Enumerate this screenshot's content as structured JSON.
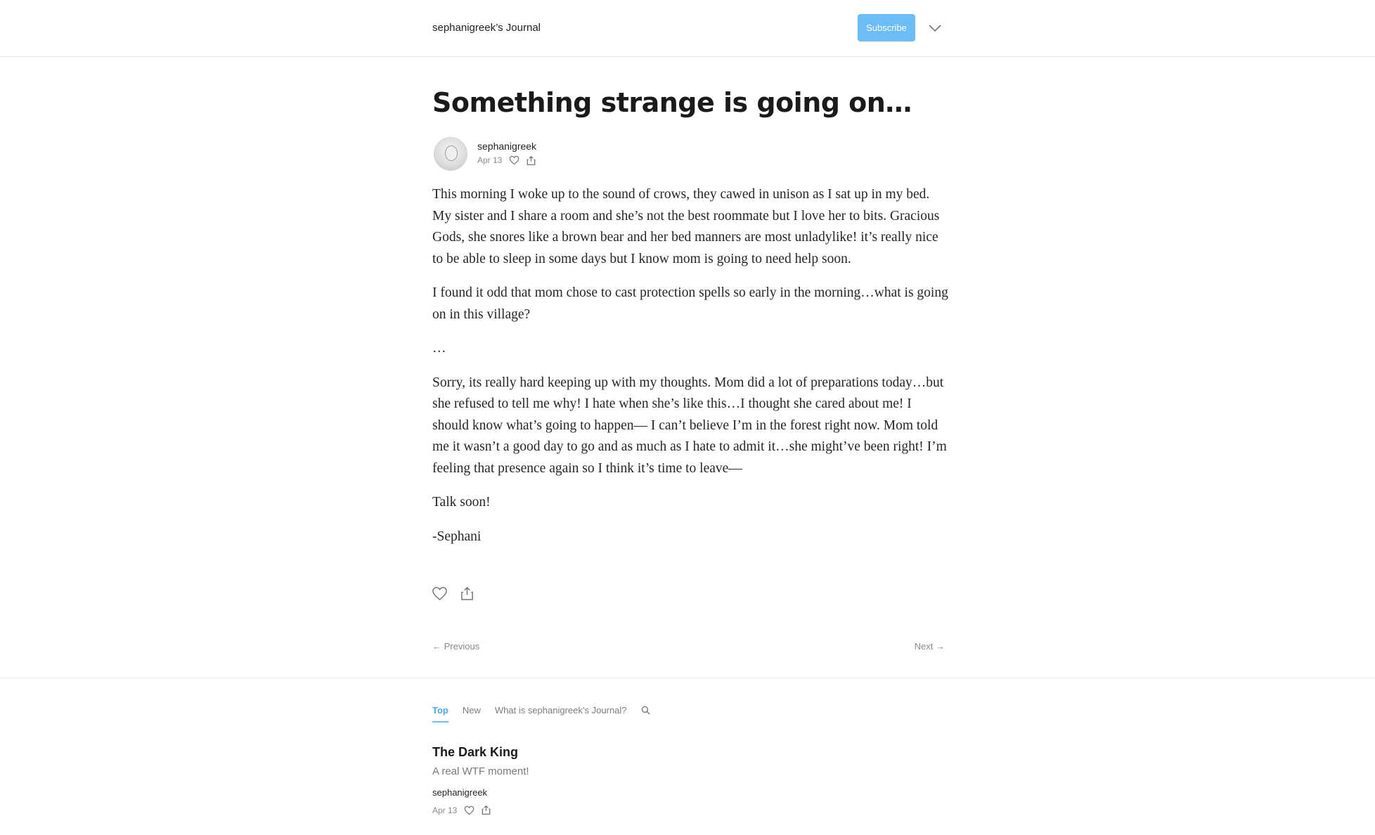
{
  "header": {
    "publication_name": "sephanigreek’s Journal",
    "subscribe_label": "Subscribe"
  },
  "post": {
    "title": "Something strange is going on…",
    "author": "sephanigreek",
    "date": "Apr 13",
    "paragraphs": [
      "This morning I woke up to the sound of crows, they cawed in unison as I sat up in my bed. My sister and I share a room and she’s not the best roommate but I love her to bits. Gracious Gods, she snores like a brown bear and her bed manners are most unladylike! it’s really nice to be able to sleep in some days but I know mom is going to need help soon.",
      "I found it odd that mom chose to cast protection spells so early in the morning…what is going on in this village?",
      "…",
      "Sorry, its really hard keeping up with my thoughts. Mom did a lot of preparations today…but she refused to tell me why! I hate when she’s like this…I thought she cared about me! I should know what’s going to happen— I can’t believe I’m in the forest right now. Mom told me it wasn’t a good day to go and as much as I hate to admit it…she might’ve been right! I’m feeling that presence again so I think it’s time to leave—",
      "Talk soon!",
      "-Sephani"
    ]
  },
  "navigation": {
    "previous_label": "← Previous",
    "next_label": "Next →"
  },
  "archive": {
    "tabs": [
      {
        "label": "Top",
        "active": true
      },
      {
        "label": "New",
        "active": false
      },
      {
        "label": "What is sephanigreek’s Journal?",
        "active": false
      }
    ],
    "items": [
      {
        "title": "The Dark King",
        "subtitle": "A real WTF moment!",
        "author": "sephanigreek",
        "date": "Apr 13"
      }
    ]
  },
  "colors": {
    "accent": "#6cbcf6",
    "muted_text": "#8a8a8a"
  },
  "icons": [
    "chevron-down-icon",
    "heart-icon",
    "share-icon",
    "search-icon"
  ]
}
